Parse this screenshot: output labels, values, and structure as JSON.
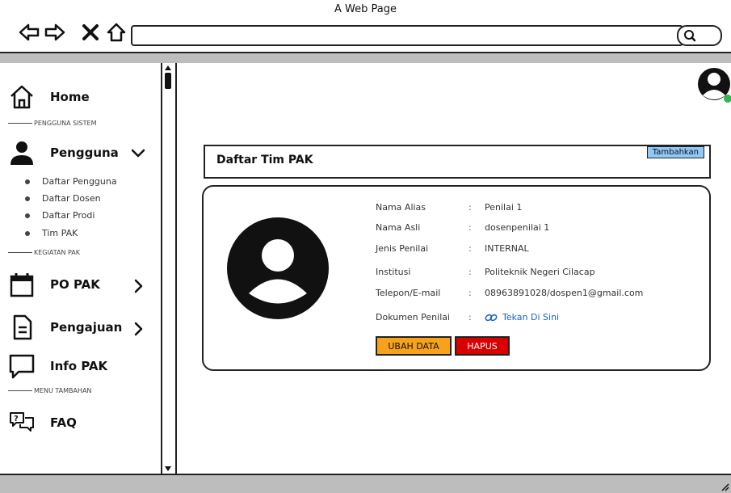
{
  "window": {
    "title": "A Web Page"
  },
  "sidebar": {
    "home": "Home",
    "section_user": "PENGGUNA SISTEM",
    "pengguna": "Pengguna",
    "subitems": [
      "Daftar Pengguna",
      "Daftar Dosen",
      "Daftar Prodi",
      "Tim PAK"
    ],
    "section_activity": "KEGIATAN PAK",
    "po_pak": "PO PAK",
    "pengajuan": "Pengajuan",
    "info_pak": "Info PAK",
    "section_extra": "MENU TAMBAHAN",
    "faq": "FAQ"
  },
  "main": {
    "panel_title": "Daftar Tim PAK",
    "add_button": "Tambahkan",
    "fields": [
      {
        "label": "Nama Alias",
        "value": "Penilai 1"
      },
      {
        "label": "Nama Asli",
        "value": "dosenpenilai 1"
      },
      {
        "label": "Jenis Penilai",
        "value": "INTERNAL"
      },
      {
        "label": "Institusi",
        "value": "Politeknik Negeri Cilacap"
      },
      {
        "label": "Telepon/E-mail",
        "value": "08963891028/dospen1@gmail.com"
      },
      {
        "label": "Dokumen Penilai",
        "value": "Tekan Di Sini"
      }
    ],
    "colon": ":",
    "edit_button": "UBAH DATA",
    "delete_button": "HAPUS"
  },
  "colors": {
    "add": "#90c8f8",
    "edit": "#f7a21b",
    "delete": "#d80000",
    "link": "#1a62c8",
    "online": "#2db84b"
  }
}
